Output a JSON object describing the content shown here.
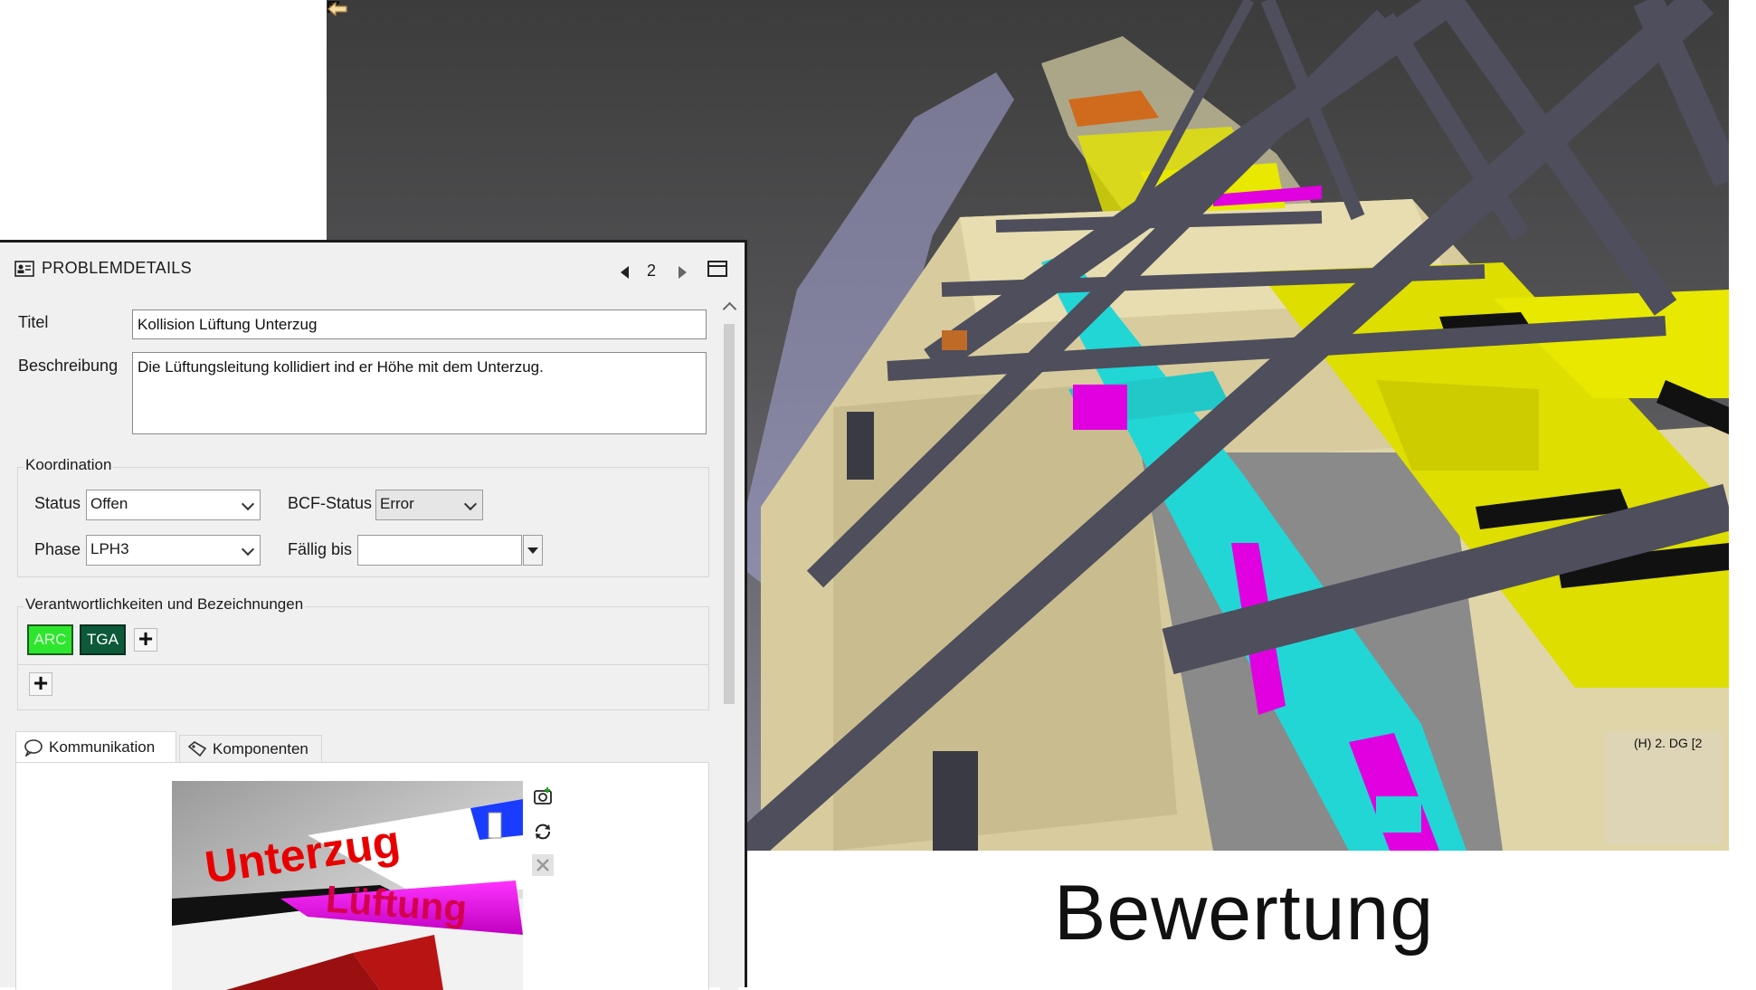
{
  "panel": {
    "title": "PROBLEMDETAILS",
    "page": "2",
    "fields": {
      "titel_label": "Titel",
      "titel_value": "Kollision Lüftung Unterzug",
      "beschreibung_label": "Beschreibung",
      "beschreibung_value": "Die Lüftungsleitung kollidiert ind er Höhe mit dem Unterzug."
    },
    "koordination": {
      "title": "Koordination",
      "status_label": "Status",
      "status_value": "Offen",
      "bcf_label": "BCF-Status",
      "bcf_value": "Error",
      "phase_label": "Phase",
      "phase_value": "LPH3",
      "faellig_label": "Fällig bis",
      "faellig_value": ""
    },
    "verantwortlichkeiten": {
      "title": "Verantwortlichkeiten und Bezeichnungen",
      "tags": [
        {
          "label": "ARC",
          "color": "#2ee62e"
        },
        {
          "label": "TGA",
          "color": "#0d5a3a"
        }
      ]
    },
    "tabs": [
      {
        "label": "Kommunikation",
        "icon": "chat-icon"
      },
      {
        "label": "Komponenten",
        "icon": "tag-icon"
      }
    ],
    "snapshot": {
      "text_unterzug": "Unterzug",
      "text_lueftung": "Lüftung"
    }
  },
  "viewport": {
    "navcube_label": "(H) 2. DG [2",
    "caption": "Bewertung"
  },
  "colors": {
    "beam": "#4e4e5c",
    "wall": "#e8ddb0",
    "duct_yellow": "#e8e800",
    "duct_cyan": "#22d6d6",
    "pipe_magenta": "#e000e0"
  }
}
